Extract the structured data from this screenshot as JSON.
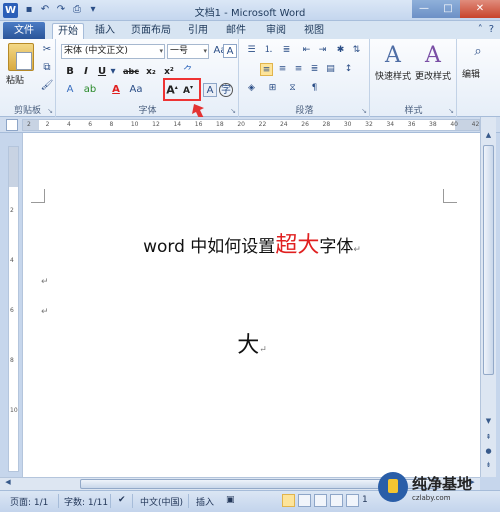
{
  "window": {
    "title": "文档1 - Microsoft Word",
    "logo": "W"
  },
  "tabs": {
    "file": "文件",
    "items": [
      {
        "label": "开始",
        "active": true
      },
      {
        "label": "插入"
      },
      {
        "label": "页面布局"
      },
      {
        "label": "引用"
      },
      {
        "label": "邮件"
      },
      {
        "label": "审阅"
      },
      {
        "label": "视图"
      }
    ]
  },
  "ribbon": {
    "clipboard": {
      "paste_label": "粘贴",
      "group_label": "剪贴板"
    },
    "font": {
      "font_name": "宋体 (中文正文)",
      "font_size": "一号",
      "bold": "B",
      "italic": "I",
      "underline": "U",
      "strikethrough": "abc",
      "subscript": "x₂",
      "superscript": "x²",
      "grow_font": "A",
      "shrink_font": "A",
      "group_label": "字体"
    },
    "paragraph": {
      "group_label": "段落"
    },
    "styles": {
      "quick_styles": "快速样式",
      "change_styles": "更改样式",
      "group_label": "样式"
    },
    "editing": {
      "label": "编辑"
    }
  },
  "ruler": {
    "ticks": [
      "2",
      "2",
      "4",
      "6",
      "8",
      "10",
      "12",
      "14",
      "16",
      "18",
      "20",
      "22",
      "24",
      "26",
      "28",
      "30",
      "32",
      "34",
      "36",
      "38",
      "40",
      "42"
    ]
  },
  "document": {
    "line1_pre": "word 中如何设置",
    "line1_big": "超大",
    "line1_post": "字体",
    "para_mark": "↵",
    "line4": "大"
  },
  "status": {
    "page": "页面: 1/1",
    "words": "字数: 1/11",
    "language": "中文(中国)",
    "mode": "插入",
    "zoom": "1"
  },
  "watermark": {
    "text": "纯净基地",
    "sub": "czlaby.com"
  },
  "colors": {
    "accent": "#2b5fb8",
    "highlight": "#e33333",
    "big_text": "#e02020"
  },
  "icons": [
    "word-logo-icon",
    "save-icon",
    "undo-icon",
    "redo-icon",
    "paste-icon",
    "cut-icon",
    "copy-icon",
    "format-painter-icon",
    "grow-font-icon",
    "shrink-font-icon",
    "bullets-icon",
    "numbering-icon",
    "align-center-icon",
    "quick-styles-icon",
    "change-styles-icon",
    "find-icon",
    "minimize-icon",
    "maximize-icon",
    "close-icon",
    "help-icon"
  ]
}
